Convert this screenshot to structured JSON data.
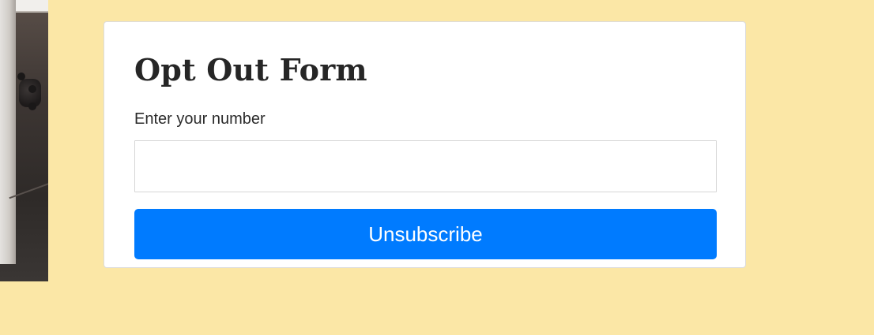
{
  "form": {
    "title": "Opt Out Form",
    "number_label": "Enter your number",
    "number_value": "",
    "submit_label": "Unsubscribe"
  },
  "colors": {
    "page_background": "#fbe7a6",
    "button_primary": "#007bff",
    "card_background": "#ffffff"
  }
}
